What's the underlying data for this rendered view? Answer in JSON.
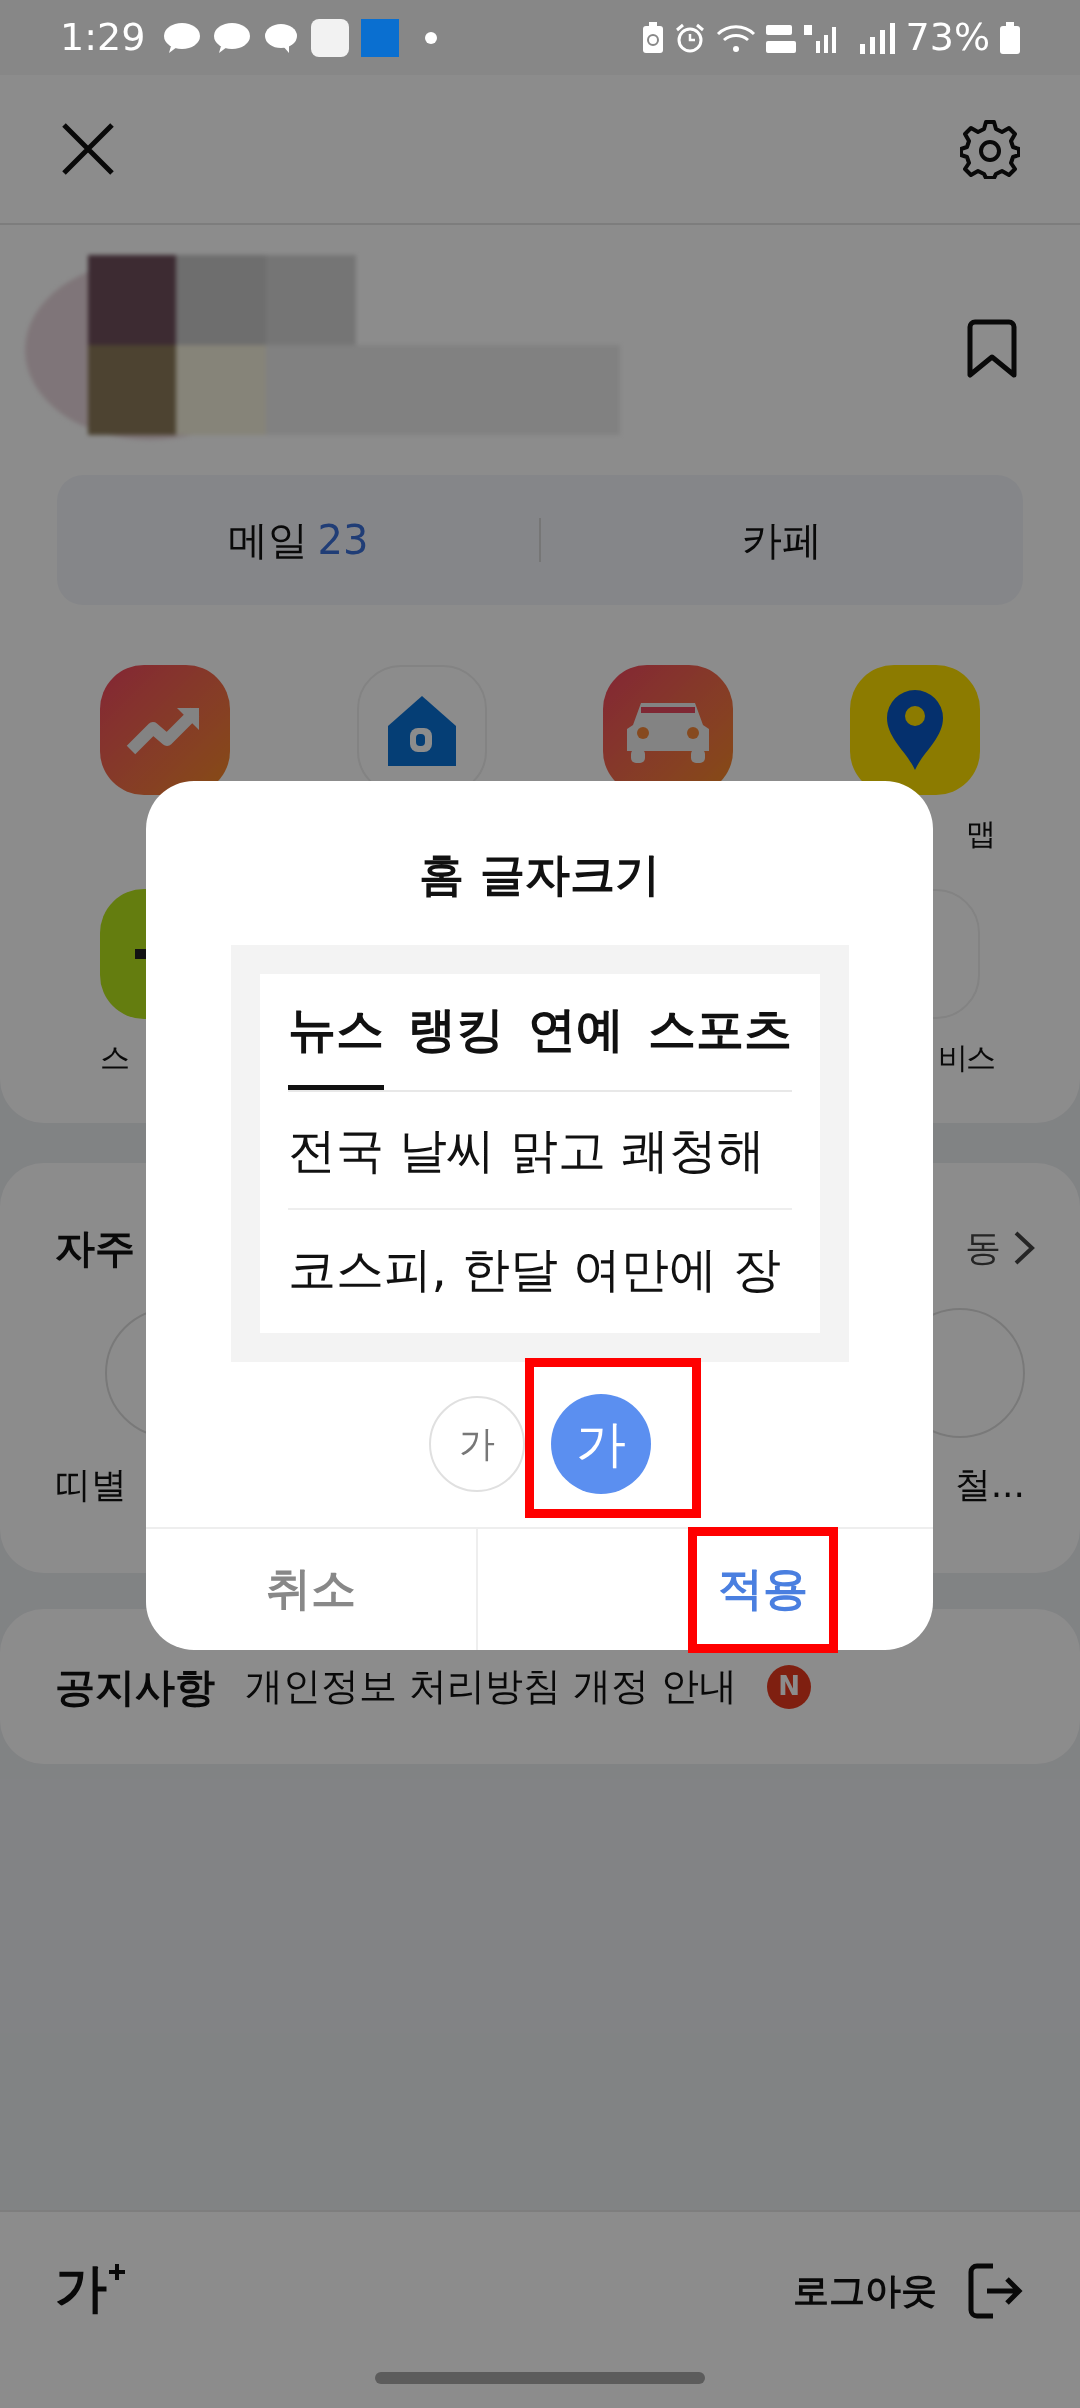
{
  "status_bar": {
    "time": "1:29",
    "battery": "73%"
  },
  "account_tabs": [
    {
      "label": "메일",
      "count": "23"
    },
    {
      "label": "카페"
    }
  ],
  "app_rows": [
    [
      {
        "kind": "chart"
      },
      {
        "kind": "house"
      },
      {
        "kind": "car"
      },
      {
        "kind": "map",
        "label": "맵"
      }
    ],
    [
      {
        "kind": "green",
        "label": "스"
      },
      {
        "kind": "white",
        "label": "비스"
      }
    ]
  ],
  "frequent": {
    "title": "자주",
    "more": "동",
    "items": [
      {
        "label": "띠별"
      },
      {
        "label": "철..."
      }
    ]
  },
  "notice": {
    "title": "공지사항",
    "text": "개인정보 처리방침 개정 안내",
    "badge": "N"
  },
  "bottom_bar": {
    "font_button": "가",
    "logout": "로그아웃"
  },
  "dialog": {
    "title": "홈 글자크기",
    "preview_tabs": [
      {
        "label": "뉴스",
        "selected": true
      },
      {
        "label": "랭킹",
        "selected": false
      },
      {
        "label": "연예",
        "selected": false
      },
      {
        "label": "스포츠",
        "selected": false
      }
    ],
    "headlines": [
      "전국 날씨 맑고 쾌청해",
      "코스피, 한달 여만에 장"
    ],
    "size_options": [
      {
        "label": "가",
        "selected": false,
        "highlighted": false
      },
      {
        "label": "가",
        "selected": true,
        "highlighted": true
      }
    ],
    "buttons": [
      {
        "kind": "cancel",
        "label": "취소",
        "highlighted": false
      },
      {
        "kind": "apply",
        "label": "적용",
        "highlighted": true
      }
    ]
  }
}
